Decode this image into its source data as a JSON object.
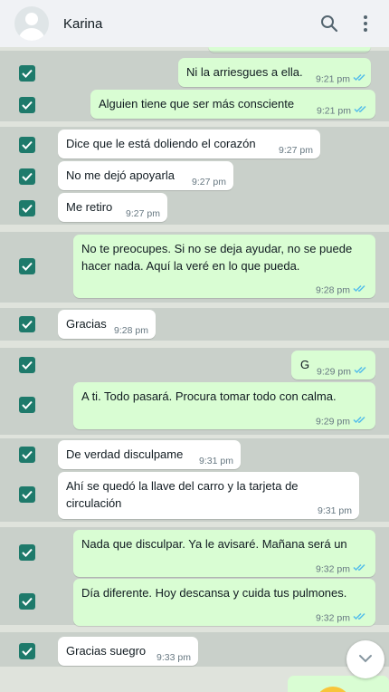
{
  "header": {
    "contact_name": "Karina",
    "icons": [
      "avatar-placeholder",
      "search-icon",
      "menu-dots-icon"
    ]
  },
  "messages": [
    {
      "id": "m1",
      "dir": "out",
      "text": "Ni la arriesgues a ella.",
      "time": "9:21 pm",
      "read": true
    },
    {
      "id": "m2",
      "dir": "out",
      "text": "Alguien tiene que ser más consciente",
      "time": "9:21 pm",
      "read": true
    },
    {
      "id": "m3",
      "dir": "in",
      "text": "Dice que le está doliendo el corazón",
      "time": "9:27 pm"
    },
    {
      "id": "m4",
      "dir": "in",
      "text": "No me dejó apoyarla",
      "time": "9:27 pm"
    },
    {
      "id": "m5",
      "dir": "in",
      "text": "Me retiro",
      "time": "9:27 pm"
    },
    {
      "id": "m6",
      "dir": "out",
      "text": "No te preocupes. Si no se deja ayudar, no se puede hacer nada. Aquí la veré en lo que pueda.",
      "time": "9:28 pm",
      "read": true
    },
    {
      "id": "m7",
      "dir": "in",
      "text": "Gracias",
      "time": "9:28 pm"
    },
    {
      "id": "m8",
      "dir": "out",
      "text": "G",
      "time": "9:29 pm",
      "read": true
    },
    {
      "id": "m9",
      "dir": "out",
      "text": "A ti. Todo pasará. Procura tomar todo con calma.",
      "time": "9:29 pm",
      "read": true
    },
    {
      "id": "m10",
      "dir": "in",
      "text": "De verdad disculpame",
      "time": "9:31 pm"
    },
    {
      "id": "m11",
      "dir": "in",
      "text": "Ahí se quedó la llave del carro y la tarjeta de circulación",
      "time": "9:31 pm"
    },
    {
      "id": "m12",
      "dir": "out",
      "text": "Nada que disculpar. Ya le avisaré. Mañana será un",
      "time": "9:32 pm",
      "read": true
    },
    {
      "id": "m13",
      "dir": "out",
      "text": "Día diferente. Hoy descansa y cuida tus pulmones.",
      "time": "9:32 pm",
      "read": true
    },
    {
      "id": "m14",
      "dir": "in",
      "text": "Gracias suegro",
      "time": "9:33 pm"
    }
  ],
  "colors": {
    "header_bg": "#f0f2f5",
    "incoming_bubble": "#ffffff",
    "outgoing_bubble": "#d9fdd3",
    "checkbox": "#1e7a6b",
    "read_ticks": "#53bdeb"
  }
}
